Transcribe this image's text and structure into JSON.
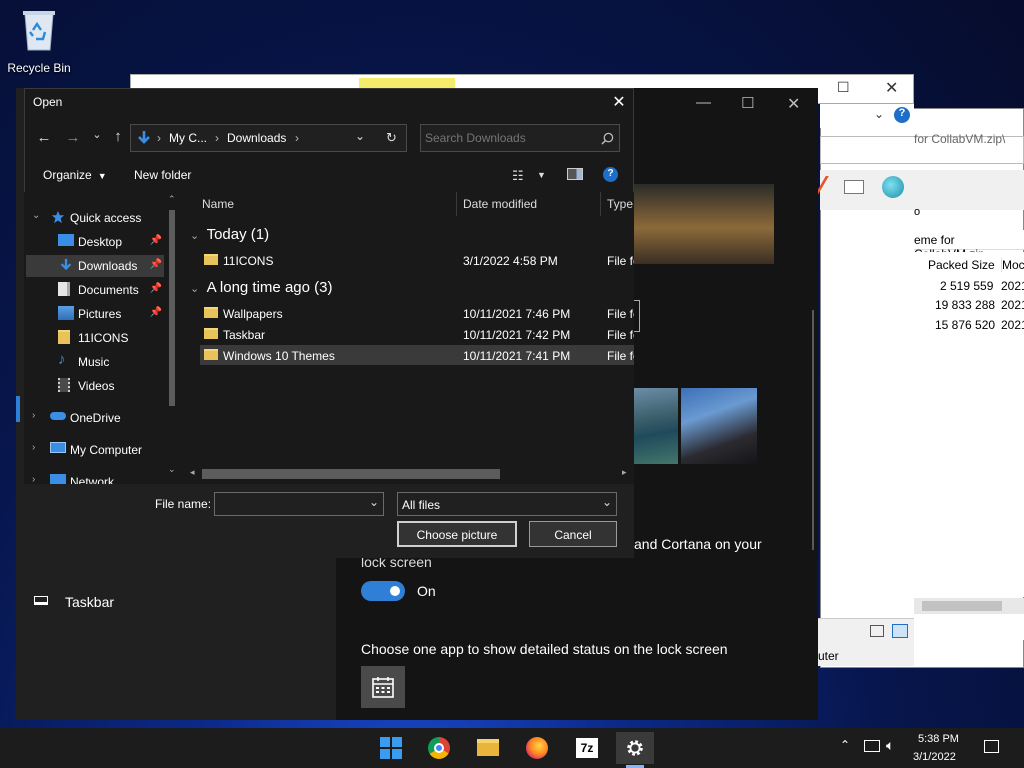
{
  "desktop": {
    "recycle_bin_label": "Recycle Bin"
  },
  "zip_window": {
    "path_partial": "for CollabVM.zip\\",
    "toolbar_partial": "o",
    "path_partial2": "eme for CollabVM.zip",
    "columns": [
      "Packed Size",
      "Moc"
    ],
    "rows": [
      {
        "packed": "2 519 559",
        "mod": "2021"
      },
      {
        "packed": "19 833 288",
        "mod": "2021"
      },
      {
        "packed": "15 876 520",
        "mod": "2021"
      }
    ],
    "status_partial": "uter"
  },
  "settings": {
    "sidebar_taskbar_label": "Taskbar",
    "cortana_text_line1": "and Cortana on your",
    "cortana_text_line2": "lock screen",
    "toggle_label": "On",
    "toggle_value": "on",
    "detailed_status_label": "Choose one app to show detailed status on the lock screen"
  },
  "dialog": {
    "title": "Open",
    "breadcrumb": [
      "My C...",
      "Downloads"
    ],
    "search_placeholder": "Search Downloads",
    "organize_label": "Organize",
    "new_folder_label": "New folder",
    "tree": [
      {
        "label": "Quick access",
        "icon": "star-icon",
        "top": true,
        "expanded": true
      },
      {
        "label": "Desktop",
        "icon": "desktop-icon",
        "pinned": true
      },
      {
        "label": "Downloads",
        "icon": "download-icon",
        "pinned": true,
        "selected": true
      },
      {
        "label": "Documents",
        "icon": "document-icon",
        "pinned": true
      },
      {
        "label": "Pictures",
        "icon": "pictures-icon",
        "pinned": true
      },
      {
        "label": "11ICONS",
        "icon": "folder-icon"
      },
      {
        "label": "Music",
        "icon": "music-icon"
      },
      {
        "label": "Videos",
        "icon": "video-icon"
      },
      {
        "label": "OneDrive",
        "icon": "cloud-icon",
        "top": true
      },
      {
        "label": "My Computer",
        "icon": "computer-icon",
        "top": true
      },
      {
        "label": "Network",
        "icon": "network-icon",
        "top": true
      }
    ],
    "columns": {
      "name": "Name",
      "date": "Date modified",
      "type": "Type"
    },
    "groups": [
      {
        "label": "Today (1)",
        "files": [
          {
            "name": "11ICONS",
            "date": "3/1/2022 4:58 PM",
            "type": "File folder"
          }
        ]
      },
      {
        "label": "A long time ago (3)",
        "files": [
          {
            "name": "Wallpapers",
            "date": "10/11/2021 7:46 PM",
            "type": "File folder"
          },
          {
            "name": "Taskbar",
            "date": "10/11/2021 7:42 PM",
            "type": "File folder"
          },
          {
            "name": "Windows 10 Themes",
            "date": "10/11/2021 7:41 PM",
            "type": "File folder",
            "selected": true
          }
        ]
      }
    ],
    "file_name_label": "File name:",
    "file_name_value": "",
    "file_type_value": "All files",
    "choose_button": "Choose picture",
    "cancel_button": "Cancel"
  },
  "taskbar": {
    "time": "5:38 PM",
    "date": "3/1/2022"
  }
}
